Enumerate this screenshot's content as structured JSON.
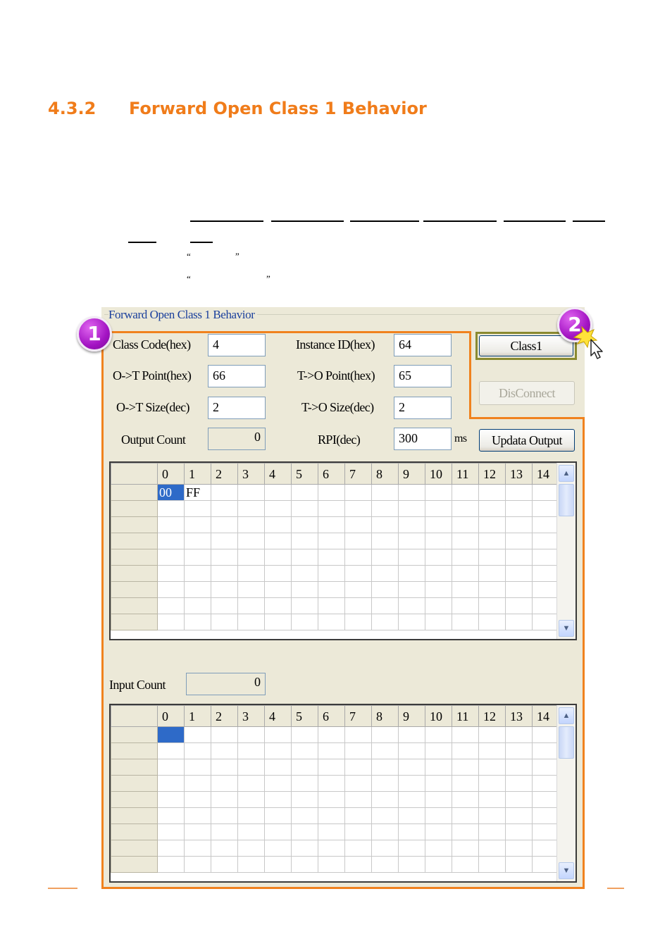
{
  "section": {
    "number": "4.3.2",
    "title": "Forward Open Class 1 Behavior"
  },
  "panel": {
    "group_title": "Forward Open Class 1 Behavior",
    "fields": {
      "class_code": {
        "label": "Class Code(hex)",
        "value": "4"
      },
      "instance_id": {
        "label": "Instance ID(hex)",
        "value": "64"
      },
      "ot_point": {
        "label": "O->T Point(hex)",
        "value": "66"
      },
      "to_point": {
        "label": "T->O Point(hex)",
        "value": "65"
      },
      "ot_size": {
        "label": "O->T Size(dec)",
        "value": "2"
      },
      "to_size": {
        "label": "T->O Size(dec)",
        "value": "2"
      },
      "output_count": {
        "label": "Output Count",
        "value": "0"
      },
      "rpi": {
        "label": "RPI(dec)",
        "value": "300",
        "unit": "ms"
      },
      "input_count": {
        "label": "Input Count",
        "value": "0"
      }
    },
    "buttons": {
      "class1": "Class1",
      "disconnect": "DisConnect",
      "update_output": "Updata Output"
    },
    "output_grid": {
      "columns": [
        "0",
        "1",
        "2",
        "3",
        "4",
        "5",
        "6",
        "7",
        "8",
        "9",
        "10",
        "11",
        "12",
        "13",
        "14"
      ],
      "row1": [
        "00",
        "FF"
      ]
    },
    "input_grid": {
      "columns": [
        "0",
        "1",
        "2",
        "3",
        "4",
        "5",
        "6",
        "7",
        "8",
        "9",
        "10",
        "11",
        "12",
        "13",
        "14"
      ]
    }
  },
  "badges": [
    "1",
    "2"
  ],
  "colors": {
    "heading": "#f07c1a",
    "highlight_outline": "#f0821e",
    "badge": "#a314c3",
    "selection": "#2e6ac8"
  }
}
